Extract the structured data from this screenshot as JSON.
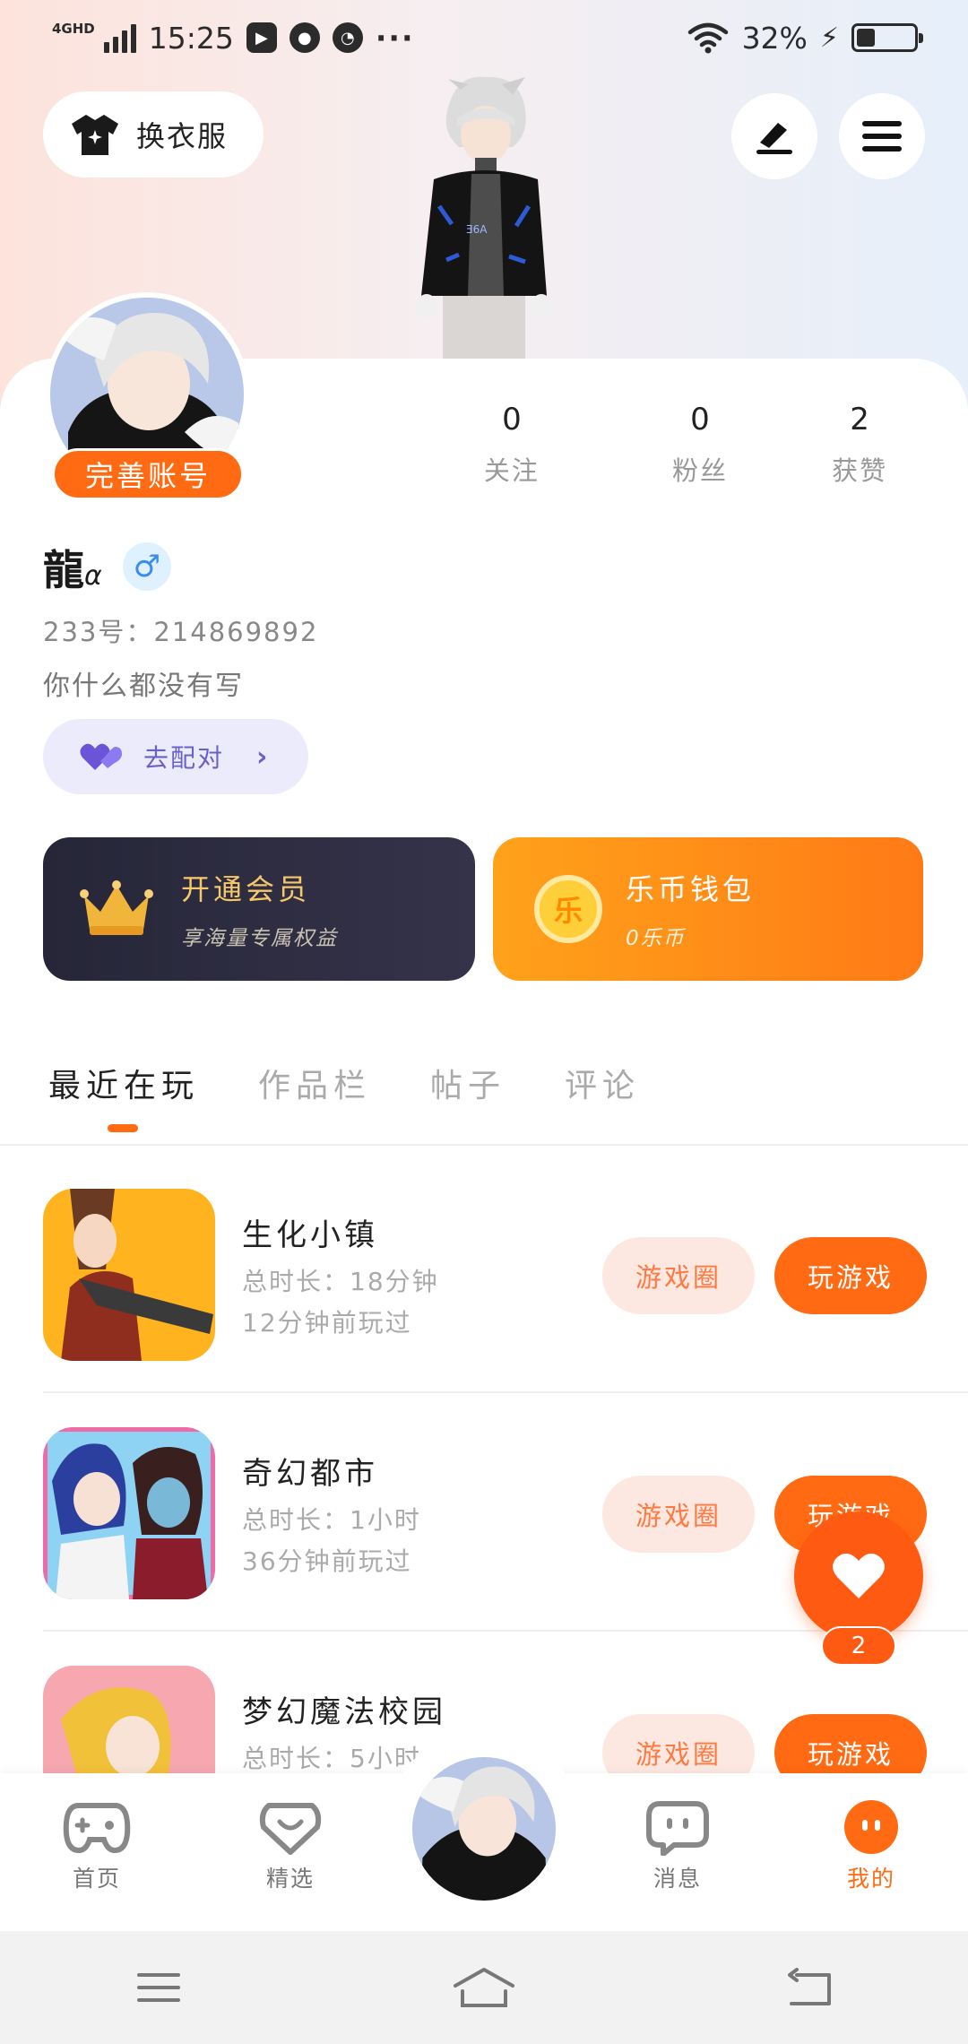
{
  "status_bar": {
    "network": "4GHD",
    "time": "15:25",
    "battery": "32%",
    "battery_level": 0.32
  },
  "header": {
    "outfit_label": "换衣服"
  },
  "profile": {
    "complete_account_label": "完善账号",
    "username": "龍",
    "username_suffix": "α",
    "gender_symbol": "♂",
    "uid": "233号：214869892",
    "bio": "你什么都没有写",
    "match_label": "去配对"
  },
  "stats": [
    {
      "value": "0",
      "label": "关注"
    },
    {
      "value": "0",
      "label": "粉丝"
    },
    {
      "value": "2",
      "label": "获赞"
    }
  ],
  "promo": {
    "vip_title": "开通会员",
    "vip_subtitle": "享海量专属权益",
    "wallet_title": "乐币钱包",
    "wallet_subtitle": "0乐币",
    "coin_glyph": "乐"
  },
  "tabs": [
    {
      "label": "最近在玩",
      "active": true
    },
    {
      "label": "作品栏",
      "active": false
    },
    {
      "label": "帖子",
      "active": false
    },
    {
      "label": "评论",
      "active": false
    }
  ],
  "games": [
    {
      "name": "生化小镇",
      "duration": "总时长：18分钟",
      "last_played": "12分钟前玩过",
      "circle_label": "游戏圈",
      "play_label": "玩游戏"
    },
    {
      "name": "奇幻都市",
      "duration": "总时长：1小时",
      "last_played": "36分钟前玩过",
      "circle_label": "游戏圈",
      "play_label": "玩游戏"
    },
    {
      "name": "梦幻魔法校园",
      "duration": "总时长：5小时",
      "last_played": "",
      "circle_label": "游戏圈",
      "play_label": "玩游戏"
    }
  ],
  "fab": {
    "count": "2"
  },
  "bottom_nav": [
    {
      "label": "首页",
      "icon": "gamepad-icon"
    },
    {
      "label": "精选",
      "icon": "heart-chat-icon"
    },
    {
      "label": "消息",
      "icon": "message-icon"
    },
    {
      "label": "我的",
      "icon": "face-icon",
      "active": true
    }
  ],
  "colors": {
    "accent": "#ff6a12",
    "vip_bg": "#2a2a3c",
    "wallet_bg": "#ff8a18",
    "match_bg": "#ecebfb"
  }
}
